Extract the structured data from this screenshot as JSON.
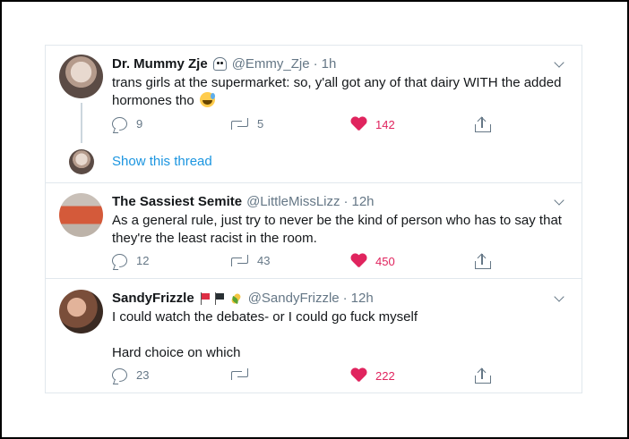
{
  "tweets": [
    {
      "name": "Dr. Mummy Zje",
      "handle": "@Emmy_Zje",
      "dot": "·",
      "time": "1h",
      "text": "trans girls at the supermarket: so, y'all got any of that dairy WITH the added hormones tho",
      "show_thread": "Show this thread",
      "replies": "9",
      "retweets": "5",
      "likes": "142"
    },
    {
      "name": "The Sassiest Semite",
      "handle": "@LittleMissLizz",
      "dot": "·",
      "time": "12h",
      "text": "As a general rule, just try to never be the kind of person who has to say that they're the least racist in the room.",
      "replies": "12",
      "retweets": "43",
      "likes": "450"
    },
    {
      "name": "SandyFrizzle",
      "handle": "@SandyFrizzle",
      "dot": "·",
      "time": "12h",
      "text": "I could watch the debates- or I could go fuck myself\n\nHard choice on which",
      "replies": "23",
      "retweets": "",
      "likes": "222"
    }
  ],
  "colors": {
    "link": "#1b95e0",
    "like": "#e0245e",
    "muted": "#657786",
    "border": "#e1e8ed"
  },
  "icons": [
    "ghost-icon",
    "red-flag-icon",
    "black-flag-icon",
    "corn-icon",
    "sweat-smile-emoji",
    "reply-icon",
    "retweet-icon",
    "heart-icon",
    "share-icon",
    "chevron-down-icon"
  ]
}
